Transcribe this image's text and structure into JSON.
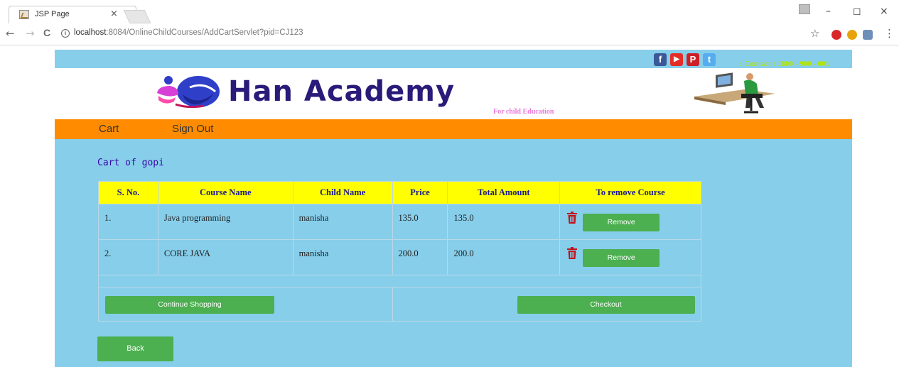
{
  "browser": {
    "tab_title": "JSP Page",
    "tab_close": "×",
    "url_host": "localhost",
    "url_path": ":8084/OnlineChildCourses/AddCartServlet?pid=CJ123",
    "info_glyph": "i",
    "back_glyph": "←",
    "forward_glyph": "→",
    "reload_glyph": "C",
    "star_glyph": "☆",
    "menu_glyph": "⋮",
    "minimize_glyph": "–",
    "restore_glyph": "◻",
    "close_glyph": "×"
  },
  "site": {
    "social": [
      {
        "icon": "facebook-icon",
        "glyph": "f",
        "color": "#3b5998"
      },
      {
        "icon": "youtube-icon",
        "glyph": "▶",
        "color": "#e52d27"
      },
      {
        "icon": "pinterest-icon",
        "glyph": "P",
        "color": "#cb2027"
      },
      {
        "icon": "twitter-icon",
        "glyph": "t",
        "color": "#55acee"
      }
    ],
    "contact": ": Contact : 1800 - 900 - 001",
    "logo_text": "Han Academy",
    "tagline": "For child Education",
    "nav": {
      "cart": "Cart",
      "sign_out": "Sign Out"
    },
    "colors": {
      "page_bg": "#87ceeb",
      "nav_bg": "#ff8c00",
      "table_header_bg": "#ffff00",
      "button_green": "#4caf50"
    }
  },
  "cart": {
    "title": "Cart of gopi",
    "headers": {
      "sno": "S. No.",
      "course": "Course Name",
      "child": "Child Name",
      "price": "Price",
      "total": "Total Amount",
      "remove": "To remove Course"
    },
    "rows": [
      {
        "sno": "1.",
        "course": "Java programming",
        "child": "manisha",
        "price": "135.0",
        "total": "135.0",
        "remove_label": "Remove"
      },
      {
        "sno": "2.",
        "course": "CORE JAVA",
        "child": "manisha",
        "price": "200.0",
        "total": "200.0",
        "remove_label": "Remove"
      }
    ],
    "continue_label": "Continue Shopping",
    "checkout_label": "Checkout",
    "back_label": "Back"
  }
}
